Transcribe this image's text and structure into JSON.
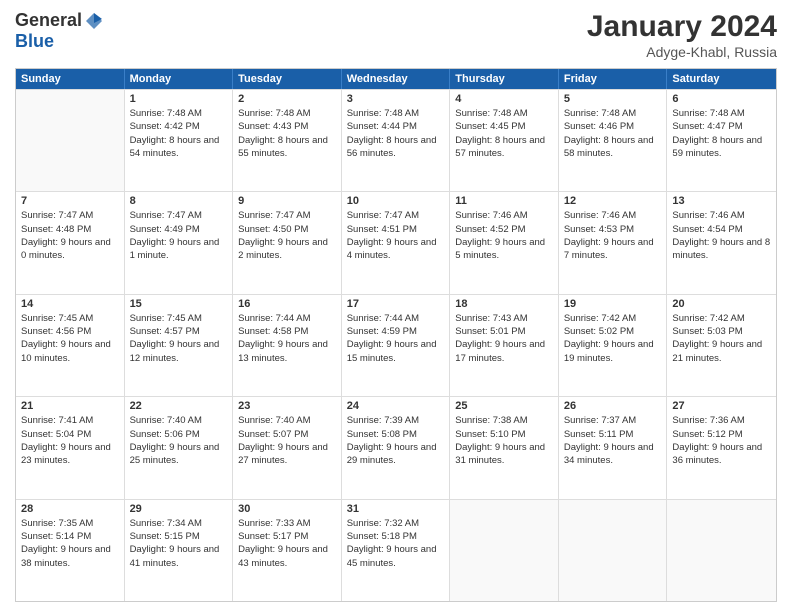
{
  "header": {
    "logo": {
      "general": "General",
      "blue": "Blue"
    },
    "title": "January 2024",
    "subtitle": "Adyge-Khabl, Russia"
  },
  "weekdays": [
    "Sunday",
    "Monday",
    "Tuesday",
    "Wednesday",
    "Thursday",
    "Friday",
    "Saturday"
  ],
  "weeks": [
    [
      {
        "day": "",
        "empty": true
      },
      {
        "day": "1",
        "sunrise": "7:48 AM",
        "sunset": "4:42 PM",
        "daylight": "8 hours and 54 minutes."
      },
      {
        "day": "2",
        "sunrise": "7:48 AM",
        "sunset": "4:43 PM",
        "daylight": "8 hours and 55 minutes."
      },
      {
        "day": "3",
        "sunrise": "7:48 AM",
        "sunset": "4:44 PM",
        "daylight": "8 hours and 56 minutes."
      },
      {
        "day": "4",
        "sunrise": "7:48 AM",
        "sunset": "4:45 PM",
        "daylight": "8 hours and 57 minutes."
      },
      {
        "day": "5",
        "sunrise": "7:48 AM",
        "sunset": "4:46 PM",
        "daylight": "8 hours and 58 minutes."
      },
      {
        "day": "6",
        "sunrise": "7:48 AM",
        "sunset": "4:47 PM",
        "daylight": "8 hours and 59 minutes."
      }
    ],
    [
      {
        "day": "7",
        "sunrise": "7:47 AM",
        "sunset": "4:48 PM",
        "daylight": "9 hours and 0 minutes."
      },
      {
        "day": "8",
        "sunrise": "7:47 AM",
        "sunset": "4:49 PM",
        "daylight": "9 hours and 1 minute."
      },
      {
        "day": "9",
        "sunrise": "7:47 AM",
        "sunset": "4:50 PM",
        "daylight": "9 hours and 2 minutes."
      },
      {
        "day": "10",
        "sunrise": "7:47 AM",
        "sunset": "4:51 PM",
        "daylight": "9 hours and 4 minutes."
      },
      {
        "day": "11",
        "sunrise": "7:46 AM",
        "sunset": "4:52 PM",
        "daylight": "9 hours and 5 minutes."
      },
      {
        "day": "12",
        "sunrise": "7:46 AM",
        "sunset": "4:53 PM",
        "daylight": "9 hours and 7 minutes."
      },
      {
        "day": "13",
        "sunrise": "7:46 AM",
        "sunset": "4:54 PM",
        "daylight": "9 hours and 8 minutes."
      }
    ],
    [
      {
        "day": "14",
        "sunrise": "7:45 AM",
        "sunset": "4:56 PM",
        "daylight": "9 hours and 10 minutes."
      },
      {
        "day": "15",
        "sunrise": "7:45 AM",
        "sunset": "4:57 PM",
        "daylight": "9 hours and 12 minutes."
      },
      {
        "day": "16",
        "sunrise": "7:44 AM",
        "sunset": "4:58 PM",
        "daylight": "9 hours and 13 minutes."
      },
      {
        "day": "17",
        "sunrise": "7:44 AM",
        "sunset": "4:59 PM",
        "daylight": "9 hours and 15 minutes."
      },
      {
        "day": "18",
        "sunrise": "7:43 AM",
        "sunset": "5:01 PM",
        "daylight": "9 hours and 17 minutes."
      },
      {
        "day": "19",
        "sunrise": "7:42 AM",
        "sunset": "5:02 PM",
        "daylight": "9 hours and 19 minutes."
      },
      {
        "day": "20",
        "sunrise": "7:42 AM",
        "sunset": "5:03 PM",
        "daylight": "9 hours and 21 minutes."
      }
    ],
    [
      {
        "day": "21",
        "sunrise": "7:41 AM",
        "sunset": "5:04 PM",
        "daylight": "9 hours and 23 minutes."
      },
      {
        "day": "22",
        "sunrise": "7:40 AM",
        "sunset": "5:06 PM",
        "daylight": "9 hours and 25 minutes."
      },
      {
        "day": "23",
        "sunrise": "7:40 AM",
        "sunset": "5:07 PM",
        "daylight": "9 hours and 27 minutes."
      },
      {
        "day": "24",
        "sunrise": "7:39 AM",
        "sunset": "5:08 PM",
        "daylight": "9 hours and 29 minutes."
      },
      {
        "day": "25",
        "sunrise": "7:38 AM",
        "sunset": "5:10 PM",
        "daylight": "9 hours and 31 minutes."
      },
      {
        "day": "26",
        "sunrise": "7:37 AM",
        "sunset": "5:11 PM",
        "daylight": "9 hours and 34 minutes."
      },
      {
        "day": "27",
        "sunrise": "7:36 AM",
        "sunset": "5:12 PM",
        "daylight": "9 hours and 36 minutes."
      }
    ],
    [
      {
        "day": "28",
        "sunrise": "7:35 AM",
        "sunset": "5:14 PM",
        "daylight": "9 hours and 38 minutes."
      },
      {
        "day": "29",
        "sunrise": "7:34 AM",
        "sunset": "5:15 PM",
        "daylight": "9 hours and 41 minutes."
      },
      {
        "day": "30",
        "sunrise": "7:33 AM",
        "sunset": "5:17 PM",
        "daylight": "9 hours and 43 minutes."
      },
      {
        "day": "31",
        "sunrise": "7:32 AM",
        "sunset": "5:18 PM",
        "daylight": "9 hours and 45 minutes."
      },
      {
        "day": "",
        "empty": true
      },
      {
        "day": "",
        "empty": true
      },
      {
        "day": "",
        "empty": true
      }
    ]
  ]
}
